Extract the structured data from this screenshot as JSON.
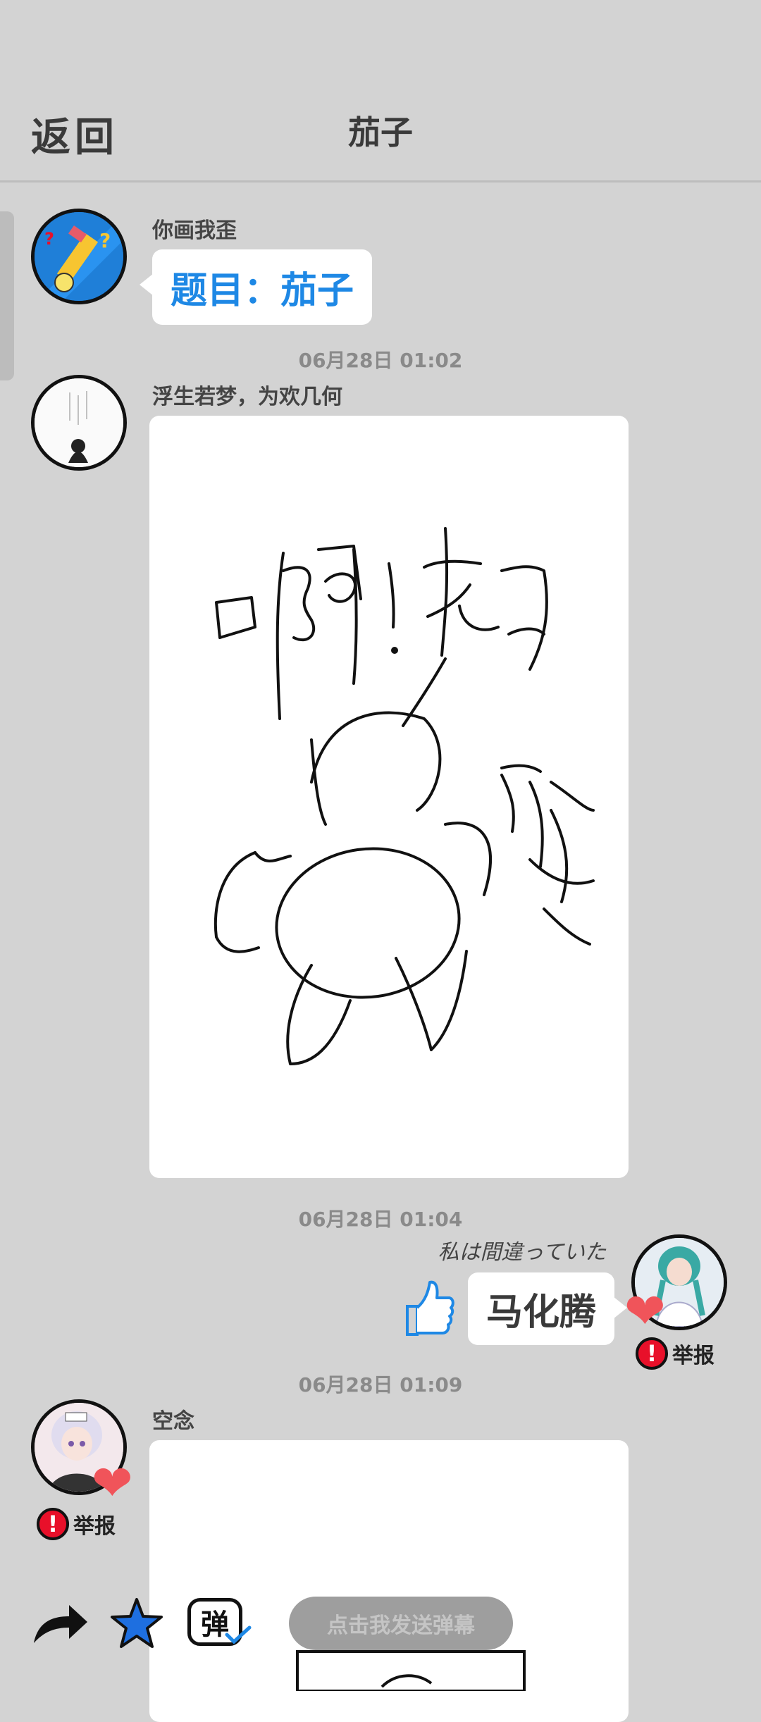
{
  "header": {
    "back_label": "返回",
    "title": "茄子"
  },
  "messages": [
    {
      "sender": "你画我歪",
      "topic": "题目：茄子"
    },
    {
      "timestamp": "06月28日  01:02",
      "sender": "浮生若梦，为欢几何"
    },
    {
      "timestamp": "06月28日  01:04",
      "sender": "私は間違っていた",
      "guess": "马化腾",
      "report_label": "举报"
    },
    {
      "timestamp": "06月28日  01:09",
      "sender": "空念",
      "report_label": "举报"
    }
  ],
  "bottom_bar": {
    "danmaku_placeholder": "点击我发送弹幕",
    "danmaku_icon_char": "弹"
  },
  "colors": {
    "background": "#d3d3d3",
    "accent_blue": "#1e88e5",
    "report_red": "#e8102a",
    "heart": "#f0545a"
  },
  "icons": [
    "back-text",
    "share-arrow-icon",
    "star-icon",
    "danmaku-icon",
    "thumbs-up-icon",
    "heart-icon",
    "report-icon"
  ]
}
